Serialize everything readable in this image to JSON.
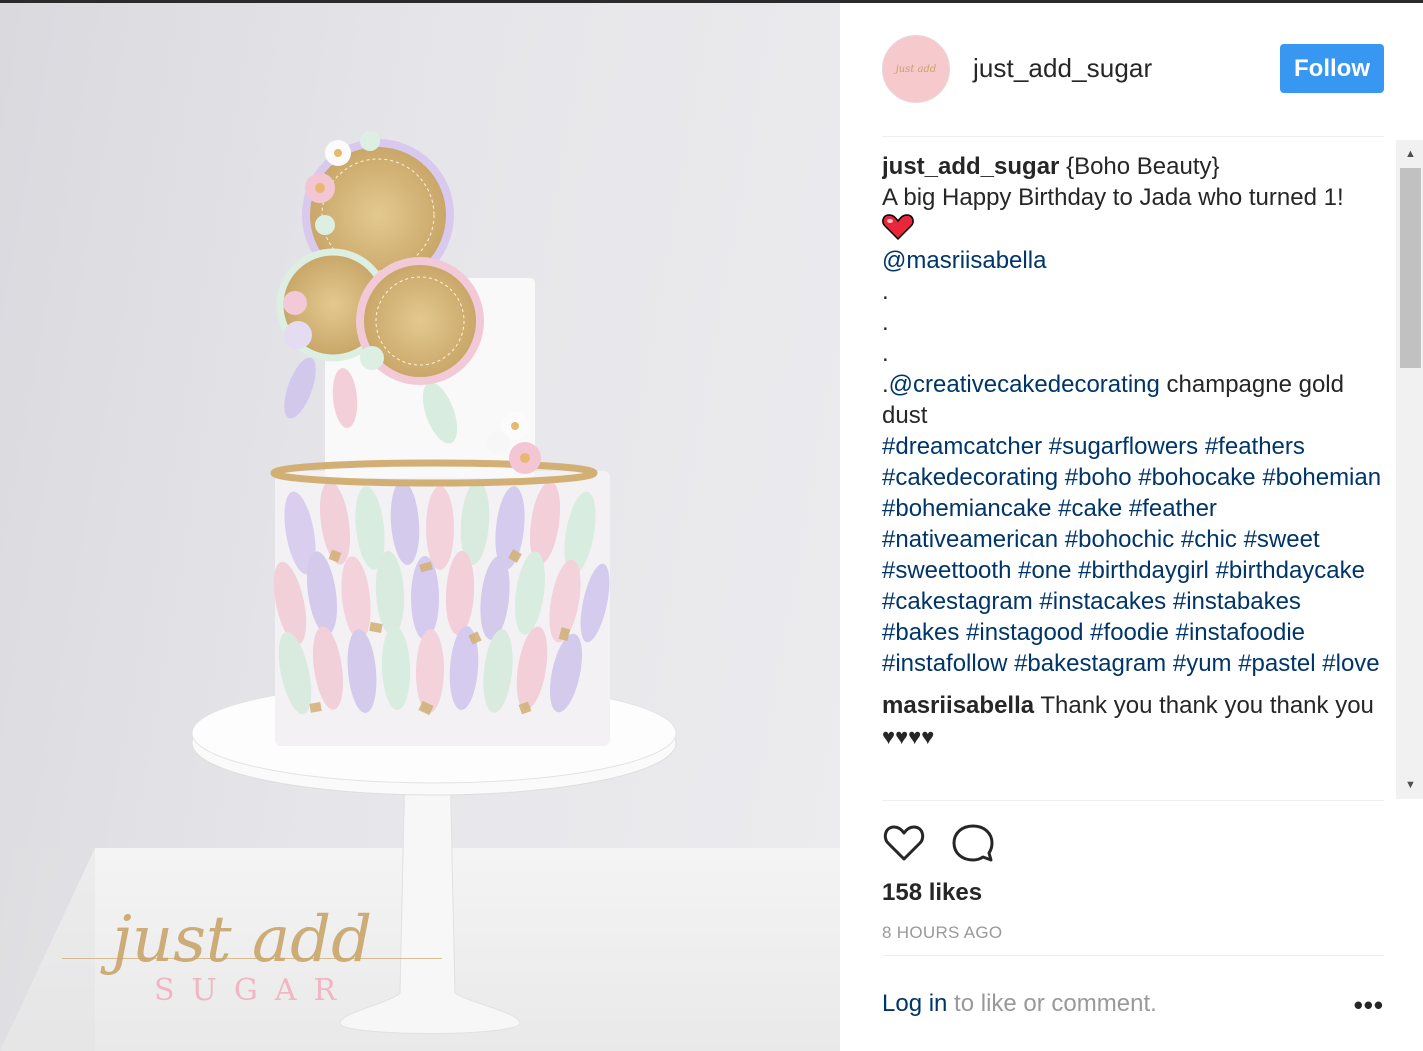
{
  "post": {
    "username": "just_add_sugar",
    "follow_label": "Follow",
    "avatar_icon": "avatar-logo",
    "watermark_script": "just add",
    "watermark_caps": "SUGAR"
  },
  "caption": {
    "username": "just_add_sugar",
    "title": "{Boho Beauty}",
    "line1": "A big Happy Birthday to Jada who turned 1!",
    "emoji": "red-heart-emoji",
    "mention1": "@masriisabella",
    "dot1": ".",
    "dot2": ".",
    "dot3": ".",
    "dot_prefix": ".",
    "mention2": "@creativecakedecorating",
    "mention2_text": " champagne gold dust",
    "hashtags": [
      "#dreamcatcher",
      "#sugarflowers",
      "#feathers",
      "#cakedecorating",
      "#boho",
      "#bohocake",
      "#bohemian",
      "#bohemiancake",
      "#cake",
      "#feather",
      "#nativeamerican",
      "#bohochic",
      "#chic",
      "#sweet",
      "#sweettooth",
      "#one",
      "#birthdaygirl",
      "#birthdaycake",
      "#cakestagram",
      "#instacakes",
      "#instabakes",
      "#bakes",
      "#instagood",
      "#foodie",
      "#instafoodie",
      "#instafollow",
      "#bakestagram",
      "#yum",
      "#pastel",
      "#love"
    ]
  },
  "comment": {
    "username": "masriisabella",
    "text": "Thank you thank you thank you",
    "hearts": "♥♥♥♥"
  },
  "engagement": {
    "likes": "158 likes",
    "timestamp": "8 HOURS AGO",
    "login_link": "Log in",
    "login_text": " to like or comment.",
    "more": "•••"
  },
  "icons": {
    "like": "heart-outline-icon",
    "comment": "comment-bubble-icon",
    "more": "more-options-icon"
  },
  "colors": {
    "follow_button": "#3897f0",
    "link": "#003569",
    "avatar_bg": "#f6c9cd"
  }
}
